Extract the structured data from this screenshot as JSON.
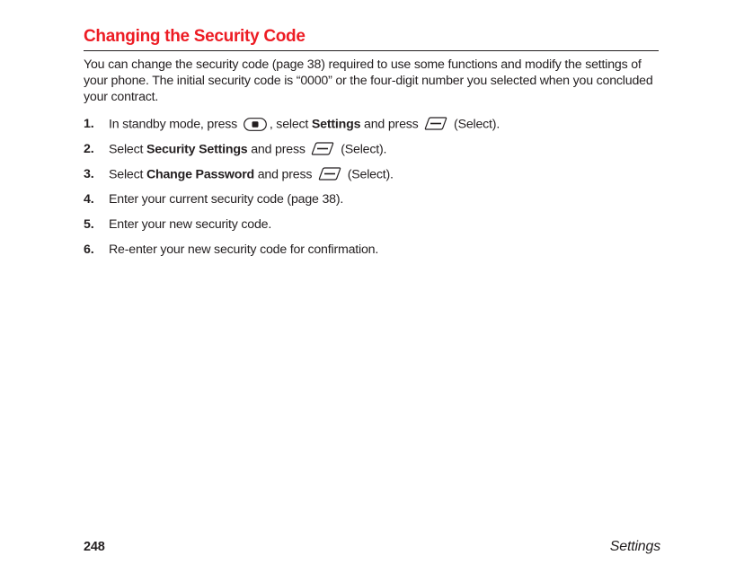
{
  "heading": "Changing the Security Code",
  "intro": "You can change the security code (page 38) required to use some functions and modify the settings of your phone. The initial security code is “0000” or the four-digit number you selected when you concluded your contract.",
  "steps": {
    "s1": {
      "num": "1.",
      "t1": "In standby mode, press ",
      "t2": ", select ",
      "bold1": "Settings",
      "t3": " and press ",
      "t4": " (Select)."
    },
    "s2": {
      "num": "2.",
      "t1": "Select ",
      "bold1": "Security Settings",
      "t2": " and press ",
      "t3": " (Select)."
    },
    "s3": {
      "num": "3.",
      "t1": "Select ",
      "bold1": "Change Password",
      "t2": " and press ",
      "t3": " (Select)."
    },
    "s4": {
      "num": "4.",
      "t1": "Enter your current security code (page 38)."
    },
    "s5": {
      "num": "5.",
      "t1": "Enter your new security code."
    },
    "s6": {
      "num": "6.",
      "t1": "Re-enter your new security code for confirmation."
    }
  },
  "footer": {
    "page": "248",
    "section": "Settings"
  }
}
